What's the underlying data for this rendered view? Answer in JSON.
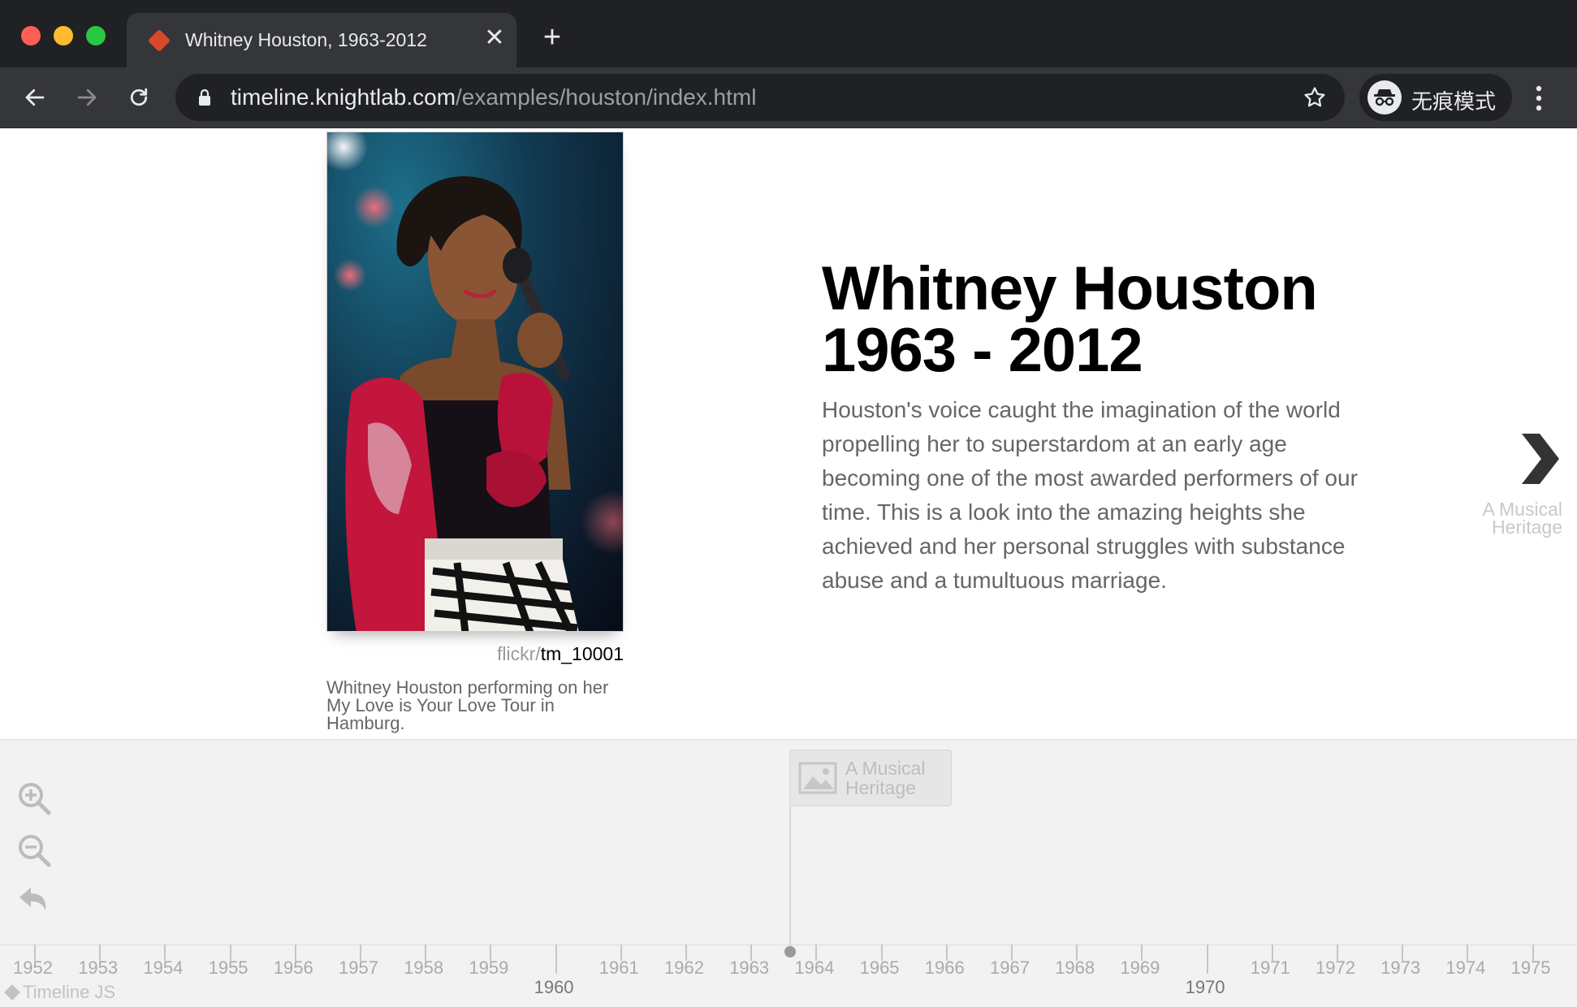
{
  "browser": {
    "tab_title": "Whitney Houston, 1963-2012",
    "close_glyph": "✕",
    "new_tab_glyph": "+",
    "url_host": "timeline.knightlab.com",
    "url_path": "/examples/houston/index.html",
    "incognito_label": "无痕模式",
    "colors": {
      "frame": "#202124",
      "toolbar": "#35363a",
      "favicon": "#d9482b"
    }
  },
  "slide": {
    "headline_line1": "Whitney Houston",
    "headline_line2": "1963 - 2012",
    "body": "Houston's voice caught the imagination of the world propelling her to superstardom at an early age becoming one of the most awarded performers of our time. This is a look into the amazing heights she achieved and her personal struggles with substance abuse and a tumultuous marriage.",
    "credit_source": "flickr/",
    "credit_author": "tm_10001",
    "caption": "Whitney Houston performing on her My Love is Your Love Tour in Hamburg.",
    "next_label": "A Musical Heritage"
  },
  "timenav": {
    "marker_label": "A Musical Heritage",
    "brand": "Timeline JS",
    "years": [
      "1952",
      "1953",
      "1954",
      "1955",
      "1956",
      "1957",
      "1958",
      "1959",
      "1960",
      "1961",
      "1962",
      "1963",
      "1964",
      "1965",
      "1966",
      "1967",
      "1968",
      "1969",
      "1970",
      "1971",
      "1972",
      "1973",
      "1974",
      "1975"
    ],
    "major_years": [
      "1960",
      "1970"
    ]
  }
}
